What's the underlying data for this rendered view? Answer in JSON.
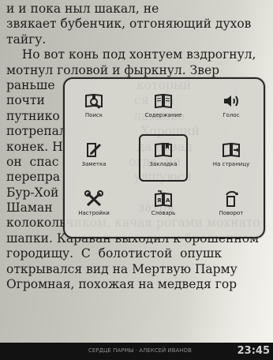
{
  "book_text": {
    "lines": [
      "и и пока ныл шакал, не",
      "звякает бубенчик, отгоняющий духов",
      "тайгу.",
      "    Но вот конь под хонтуем вздрогнул,",
      "мотнул головой и фыркнул. Звер",
      "раньше                     который",
      "почти                       ся   за",
      "путнико                   ласково",
      "потрепал                   Хороший",
      "конек. Н                   да назад",
      "он  спас                  огда  не",
      "перепра                   увшуюся",
      "Бур-Хой                          ",
      "Шаман                      затря",
      "колокольчиком, качая рогами мохнато",
      "шапки. Караван выходил к брошенном",
      "городищу.  С  болотистой  опушк",
      "открывался вид на Мертвую Парму",
      "Огромная, похожая на медведя гор"
    ]
  },
  "menu": {
    "items": [
      {
        "label": "Поиск",
        "icon": "search-book-icon"
      },
      {
        "label": "Содержание",
        "icon": "open-book-icon"
      },
      {
        "label": "Голос",
        "icon": "speaker-icon"
      },
      {
        "label": "Заметка",
        "icon": "note-pencil-icon"
      },
      {
        "label": "Закладка",
        "icon": "bookmark-book-icon"
      },
      {
        "label": "На страницу",
        "icon": "goto-page-icon"
      },
      {
        "label": "Настройки",
        "icon": "settings-tools-icon"
      },
      {
        "label": "Словарь",
        "icon": "dictionary-icon"
      },
      {
        "label": "Поворот",
        "icon": "rotate-icon"
      }
    ],
    "selected_label": "Закладка"
  },
  "status_bar": {
    "title": "СЕРДЦЕ ПАРМЫ · АЛЕКСЕЙ ИВАНОВ",
    "time": "23:45"
  }
}
